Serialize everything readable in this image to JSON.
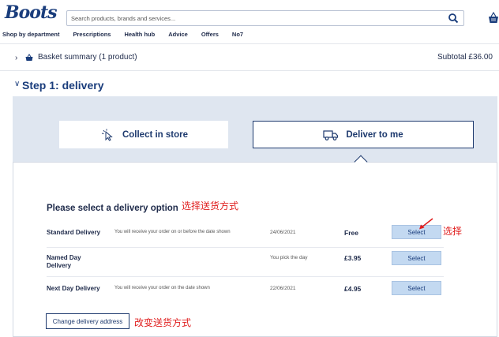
{
  "header": {
    "logo_text": "Boots",
    "search": {
      "placeholder": "Search products, brands and services..."
    },
    "nav": [
      "Shop by department",
      "Prescriptions",
      "Health hub",
      "Advice",
      "Offers",
      "No7"
    ]
  },
  "basket_summary": {
    "label": "Basket summary (1 product)",
    "subtotal": "Subtotal £36.00"
  },
  "step": {
    "title": "Step 1: delivery"
  },
  "tabs": {
    "collect": {
      "label": "Collect in store",
      "icon": "cursor-click-icon"
    },
    "deliver": {
      "label": "Deliver to me",
      "icon": "delivery-truck-icon"
    }
  },
  "delivery": {
    "title": "Please select a delivery option",
    "options": [
      {
        "name": "Standard Delivery",
        "desc": "You will receive your order on or before the date shown",
        "date": "24/06/2021",
        "price": "Free",
        "button": "Select"
      },
      {
        "name": "Named Day Delivery",
        "desc": "",
        "date": "You pick the day",
        "price": "£3.95",
        "button": "Select"
      },
      {
        "name": "Next Day Delivery",
        "desc": "You will receive your order on the date shown",
        "date": "22/06/2021",
        "price": "£4.95",
        "button": "Select"
      }
    ],
    "change_button": "Change delivery address"
  },
  "annotations": {
    "title_note": "选择送货方式",
    "select_note": "选择",
    "change_note": "改变送货方式",
    "color": "#e02020"
  },
  "colors": {
    "brand_navy": "#1a3d7c",
    "panel_bg": "#dfe6f0",
    "select_bg": "#c3d9f1"
  }
}
